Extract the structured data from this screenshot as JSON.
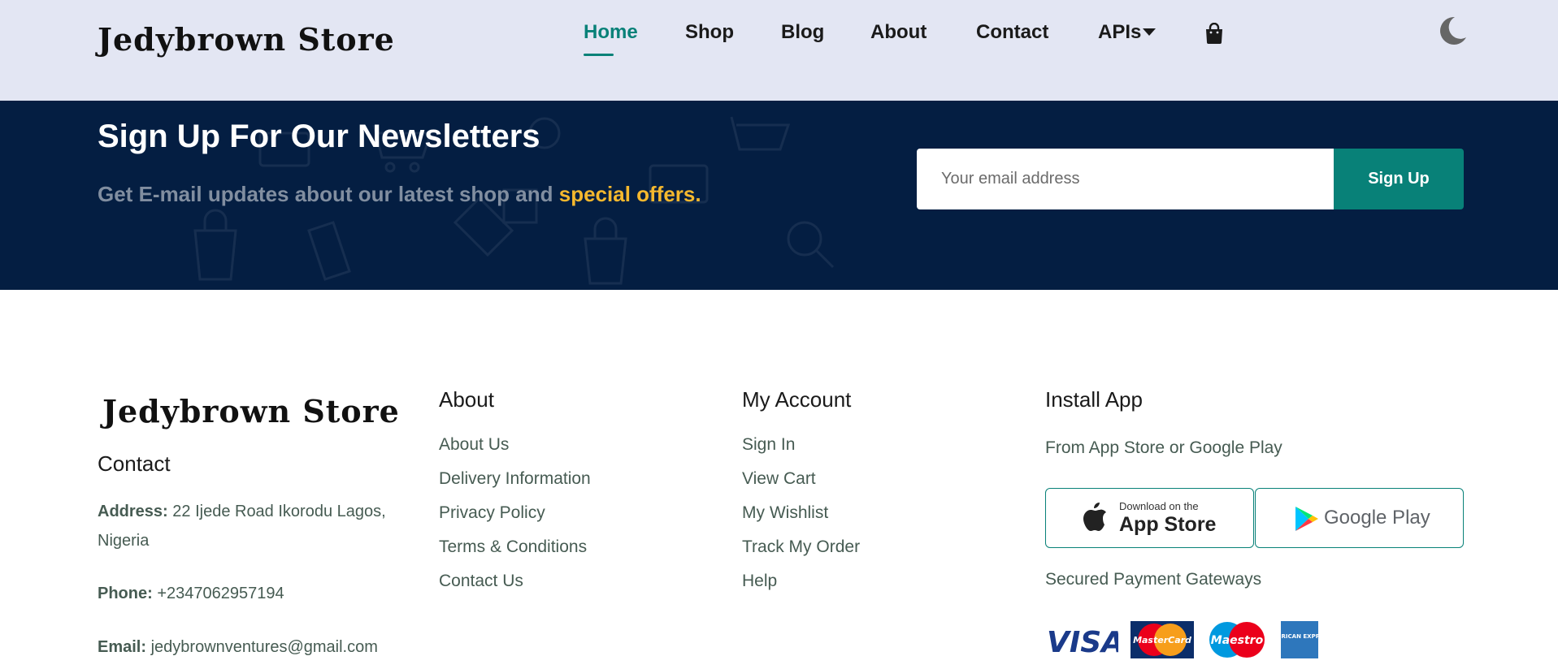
{
  "header": {
    "logo": "Jedybrown Store",
    "nav": [
      {
        "label": "Home",
        "active": true
      },
      {
        "label": "Shop"
      },
      {
        "label": "Blog"
      },
      {
        "label": "About"
      },
      {
        "label": "Contact"
      },
      {
        "label": "APIs"
      }
    ],
    "cart_icon": "shopping-bag-icon",
    "theme_icon": "moon-icon"
  },
  "newsletter": {
    "title": "Sign Up For Our Newsletters",
    "subtitle": "Get E-mail updates about our latest shop and",
    "highlight": "special offers.",
    "email_placeholder": "Your email address",
    "button": "Sign Up"
  },
  "footer": {
    "logo": "Jedybrown Store",
    "contact": {
      "title": "Contact",
      "address_label": "Address:",
      "address_line1": "22 Ijede Road Ikorodu Lagos,",
      "address_line2": "Nigeria",
      "phone_label": "Phone:",
      "phone": "+2347062957194",
      "email_label": "Email:",
      "email": "jedybrownventures@gmail.com"
    },
    "about": {
      "title": "About",
      "links": [
        "About Us",
        "Delivery Information",
        "Privacy Policy",
        "Terms & Conditions",
        "Contact Us"
      ]
    },
    "account": {
      "title": "My Account",
      "links": [
        "Sign In",
        "View Cart",
        "My Wishlist",
        "Track My Order",
        "Help"
      ]
    },
    "install": {
      "title": "Install App",
      "subtitle": "From App Store or Google Play",
      "app_store_small": "Download on the",
      "app_store_big": "App Store",
      "google_play": "Google Play",
      "payments_title": "Secured Payment Gateways",
      "payments": [
        "VISA",
        "MasterCard",
        "Maestro",
        "AMERICAN EXPRESS"
      ]
    }
  },
  "colors": {
    "accent": "#088178",
    "header_bg": "#e3e6f3",
    "newsletter_bg": "#041e42",
    "highlight": "#f5b82e"
  }
}
